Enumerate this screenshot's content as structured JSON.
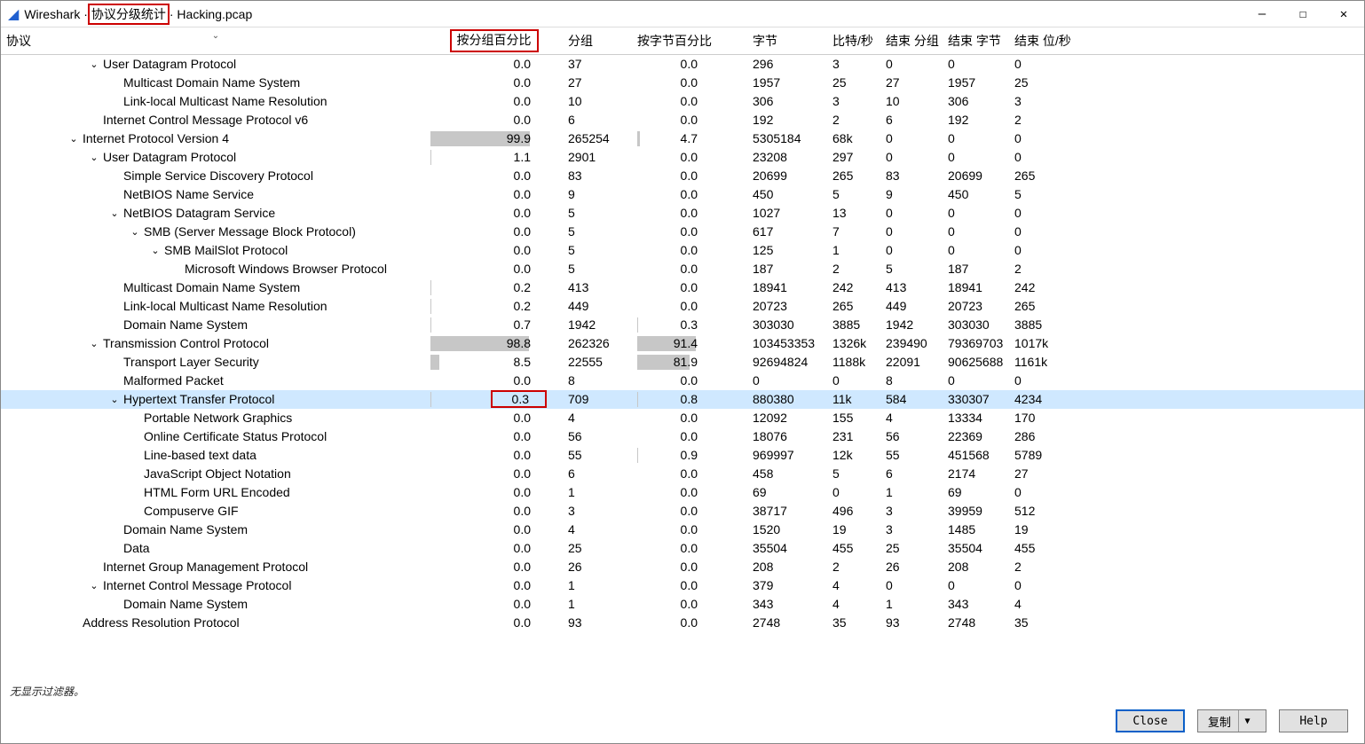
{
  "title": {
    "pre": "Wireshark · ",
    "mid": "协议分级统计",
    "post": " · Hacking.pcap"
  },
  "window_controls": {
    "min": "—",
    "max": "☐",
    "close": "✕"
  },
  "headers": {
    "proto": "协议",
    "pct_packets": "按分组百分比",
    "packets": "分组",
    "pct_bytes": "按字节百分比",
    "bytes": "字节",
    "bits": "比特/秒",
    "end_packets": "结束 分组",
    "end_bytes": "结束 字节",
    "end_bits": "结束 位/秒"
  },
  "status_text": "无显示过滤器。",
  "buttons": {
    "close": "Close",
    "copy": "复制",
    "help": "Help"
  },
  "rows": [
    {
      "indent": 4,
      "exp": "v",
      "name": "User Datagram Protocol",
      "pp": "0.0",
      "pkt": "37",
      "pb": "0.0",
      "byt": "296",
      "bps": "3",
      "ep": "0",
      "eby": "0",
      "ebp": "0"
    },
    {
      "indent": 5,
      "name": "Multicast Domain Name System",
      "pp": "0.0",
      "pkt": "27",
      "pb": "0.0",
      "byt": "1957",
      "bps": "25",
      "ep": "27",
      "eby": "1957",
      "ebp": "25"
    },
    {
      "indent": 5,
      "name": "Link-local Multicast Name Resolution",
      "pp": "0.0",
      "pkt": "10",
      "pb": "0.0",
      "byt": "306",
      "bps": "3",
      "ep": "10",
      "eby": "306",
      "ebp": "3"
    },
    {
      "indent": 4,
      "name": "Internet Control Message Protocol v6",
      "pp": "0.0",
      "pkt": "6",
      "pb": "0.0",
      "byt": "192",
      "bps": "2",
      "ep": "6",
      "eby": "192",
      "ebp": "2"
    },
    {
      "indent": 3,
      "exp": "v",
      "name": "Internet Protocol Version 4",
      "pp": "99.9",
      "ppbar": 99.9,
      "pkt": "265254",
      "pb": "4.7",
      "pbbar": 4.7,
      "byt": "5305184",
      "bps": "68k",
      "ep": "0",
      "eby": "0",
      "ebp": "0"
    },
    {
      "indent": 4,
      "exp": "v",
      "name": "User Datagram Protocol",
      "pp": "1.1",
      "ppbar": 1.1,
      "pkt": "2901",
      "pb": "0.0",
      "byt": "23208",
      "bps": "297",
      "ep": "0",
      "eby": "0",
      "ebp": "0"
    },
    {
      "indent": 5,
      "name": "Simple Service Discovery Protocol",
      "pp": "0.0",
      "pkt": "83",
      "pb": "0.0",
      "byt": "20699",
      "bps": "265",
      "ep": "83",
      "eby": "20699",
      "ebp": "265"
    },
    {
      "indent": 5,
      "name": "NetBIOS Name Service",
      "pp": "0.0",
      "pkt": "9",
      "pb": "0.0",
      "byt": "450",
      "bps": "5",
      "ep": "9",
      "eby": "450",
      "ebp": "5"
    },
    {
      "indent": 5,
      "exp": "v",
      "name": "NetBIOS Datagram Service",
      "pp": "0.0",
      "pkt": "5",
      "pb": "0.0",
      "byt": "1027",
      "bps": "13",
      "ep": "0",
      "eby": "0",
      "ebp": "0"
    },
    {
      "indent": 6,
      "exp": "v",
      "name": "SMB (Server Message Block Protocol)",
      "pp": "0.0",
      "pkt": "5",
      "pb": "0.0",
      "byt": "617",
      "bps": "7",
      "ep": "0",
      "eby": "0",
      "ebp": "0"
    },
    {
      "indent": 7,
      "exp": "v",
      "name": "SMB MailSlot Protocol",
      "pp": "0.0",
      "pkt": "5",
      "pb": "0.0",
      "byt": "125",
      "bps": "1",
      "ep": "0",
      "eby": "0",
      "ebp": "0"
    },
    {
      "indent": 8,
      "name": "Microsoft Windows Browser Protocol",
      "pp": "0.0",
      "pkt": "5",
      "pb": "0.0",
      "byt": "187",
      "bps": "2",
      "ep": "5",
      "eby": "187",
      "ebp": "2"
    },
    {
      "indent": 5,
      "name": "Multicast Domain Name System",
      "pp": "0.2",
      "ppbar": 0.2,
      "pkt": "413",
      "pb": "0.0",
      "byt": "18941",
      "bps": "242",
      "ep": "413",
      "eby": "18941",
      "ebp": "242"
    },
    {
      "indent": 5,
      "name": "Link-local Multicast Name Resolution",
      "pp": "0.2",
      "ppbar": 0.2,
      "pkt": "449",
      "pb": "0.0",
      "byt": "20723",
      "bps": "265",
      "ep": "449",
      "eby": "20723",
      "ebp": "265"
    },
    {
      "indent": 5,
      "name": "Domain Name System",
      "pp": "0.7",
      "ppbar": 0.7,
      "pkt": "1942",
      "pb": "0.3",
      "pbbar": 0.3,
      "byt": "303030",
      "bps": "3885",
      "ep": "1942",
      "eby": "303030",
      "ebp": "3885"
    },
    {
      "indent": 4,
      "exp": "v",
      "name": "Transmission Control Protocol",
      "pp": "98.8",
      "ppbar": 98.8,
      "pkt": "262326",
      "pb": "91.4",
      "pbbar": 91.4,
      "byt": "103453353",
      "bps": "1326k",
      "ep": "239490",
      "eby": "79369703",
      "ebp": "1017k"
    },
    {
      "indent": 5,
      "name": "Transport Layer Security",
      "pp": "8.5",
      "ppbar": 8.5,
      "pkt": "22555",
      "pb": "81.9",
      "pbbar": 81.9,
      "byt": "92694824",
      "bps": "1188k",
      "ep": "22091",
      "eby": "90625688",
      "ebp": "1161k"
    },
    {
      "indent": 5,
      "name": "Malformed Packet",
      "pp": "0.0",
      "pkt": "8",
      "pb": "0.0",
      "byt": "0",
      "bps": "0",
      "ep": "8",
      "eby": "0",
      "ebp": "0"
    },
    {
      "indent": 5,
      "exp": "v",
      "name": "Hypertext Transfer Protocol",
      "pp": "0.3",
      "ppbar": 0.3,
      "hl_pp": true,
      "pkt": "709",
      "pb": "0.8",
      "pbbar": 0.8,
      "byt": "880380",
      "bps": "11k",
      "ep": "584",
      "eby": "330307",
      "ebp": "4234",
      "selected": true
    },
    {
      "indent": 6,
      "name": "Portable Network Graphics",
      "pp": "0.0",
      "pkt": "4",
      "pb": "0.0",
      "byt": "12092",
      "bps": "155",
      "ep": "4",
      "eby": "13334",
      "ebp": "170"
    },
    {
      "indent": 6,
      "name": "Online Certificate Status Protocol",
      "pp": "0.0",
      "pkt": "56",
      "pb": "0.0",
      "byt": "18076",
      "bps": "231",
      "ep": "56",
      "eby": "22369",
      "ebp": "286"
    },
    {
      "indent": 6,
      "name": "Line-based text data",
      "pp": "0.0",
      "pkt": "55",
      "pb": "0.9",
      "pbbar": 0.9,
      "byt": "969997",
      "bps": "12k",
      "ep": "55",
      "eby": "451568",
      "ebp": "5789"
    },
    {
      "indent": 6,
      "name": "JavaScript Object Notation",
      "pp": "0.0",
      "pkt": "6",
      "pb": "0.0",
      "byt": "458",
      "bps": "5",
      "ep": "6",
      "eby": "2174",
      "ebp": "27"
    },
    {
      "indent": 6,
      "name": "HTML Form URL Encoded",
      "pp": "0.0",
      "pkt": "1",
      "pb": "0.0",
      "byt": "69",
      "bps": "0",
      "ep": "1",
      "eby": "69",
      "ebp": "0"
    },
    {
      "indent": 6,
      "name": "Compuserve GIF",
      "pp": "0.0",
      "pkt": "3",
      "pb": "0.0",
      "byt": "38717",
      "bps": "496",
      "ep": "3",
      "eby": "39959",
      "ebp": "512"
    },
    {
      "indent": 5,
      "name": "Domain Name System",
      "pp": "0.0",
      "pkt": "4",
      "pb": "0.0",
      "byt": "1520",
      "bps": "19",
      "ep": "3",
      "eby": "1485",
      "ebp": "19"
    },
    {
      "indent": 5,
      "name": "Data",
      "pp": "0.0",
      "pkt": "25",
      "pb": "0.0",
      "byt": "35504",
      "bps": "455",
      "ep": "25",
      "eby": "35504",
      "ebp": "455"
    },
    {
      "indent": 4,
      "name": "Internet Group Management Protocol",
      "pp": "0.0",
      "pkt": "26",
      "pb": "0.0",
      "byt": "208",
      "bps": "2",
      "ep": "26",
      "eby": "208",
      "ebp": "2"
    },
    {
      "indent": 4,
      "exp": "v",
      "name": "Internet Control Message Protocol",
      "pp": "0.0",
      "pkt": "1",
      "pb": "0.0",
      "byt": "379",
      "bps": "4",
      "ep": "0",
      "eby": "0",
      "ebp": "0"
    },
    {
      "indent": 5,
      "name": "Domain Name System",
      "pp": "0.0",
      "pkt": "1",
      "pb": "0.0",
      "byt": "343",
      "bps": "4",
      "ep": "1",
      "eby": "343",
      "ebp": "4"
    },
    {
      "indent": 3,
      "name": "Address Resolution Protocol",
      "pp": "0.0",
      "pkt": "93",
      "pb": "0.0",
      "byt": "2748",
      "bps": "35",
      "ep": "93",
      "eby": "2748",
      "ebp": "35"
    }
  ]
}
